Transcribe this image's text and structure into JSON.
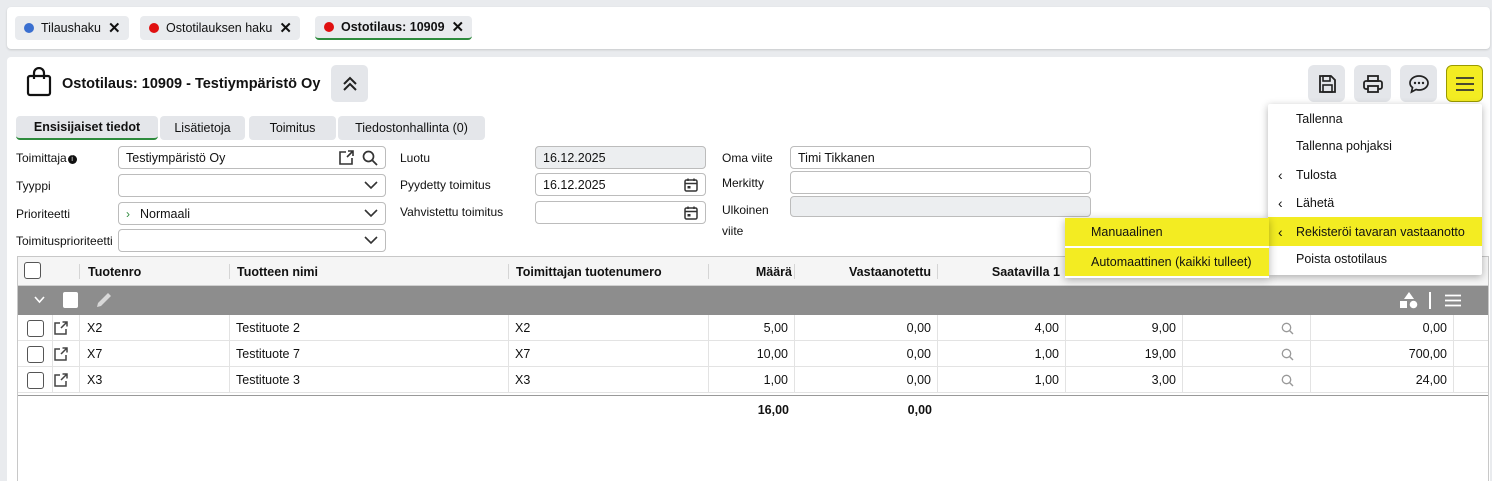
{
  "page_tabs": [
    {
      "label": "Tilaushaku",
      "dot_color": "#3a6fd0"
    },
    {
      "label": "Ostotilauksen haku",
      "dot_color": "#e01010"
    },
    {
      "label": "Ostotilaus: 10909",
      "dot_color": "#e01010",
      "active": true
    }
  ],
  "header": {
    "title": "Ostotilaus: 10909 - Testiympäristö Oy"
  },
  "sub_tabs": [
    "Ensisijaiset tiedot",
    "Lisätietoja",
    "Toimitus",
    "Tiedostonhallinta (0)"
  ],
  "form": {
    "supplier_label": "Toimittaja",
    "supplier_value": "Testiympäristö Oy",
    "type_label": "Tyyppi",
    "type_value": "",
    "priority_label": "Prioriteetti",
    "priority_value": "Normaali",
    "delivery_priority_label": "Toimitusprioriteetti",
    "delivery_priority_value": "",
    "created_label": "Luotu",
    "created_value": "16.12.2025",
    "requested_label": "Pyydetty toimitus",
    "requested_value": "16.12.2025",
    "confirmed_label": "Vahvistettu toimitus",
    "confirmed_value": "",
    "own_ref_label": "Oma viite",
    "own_ref_value": "Timi Tikkanen",
    "marked_label": "Merkitty",
    "marked_value": "",
    "ext_ref_label_1": "Ulkoinen",
    "ext_ref_label_2": "viite",
    "ext_ref_value": ""
  },
  "grid": {
    "columns": [
      "Tuotenro",
      "Tuotteen nimi",
      "Toimittajan tuotenumero",
      "Määrä",
      "Vastaanotettu",
      "Saatavilla 1"
    ],
    "rows": [
      {
        "code": "X2",
        "name": "Testituote 2",
        "supplier_code": "X2",
        "qty": "5,00",
        "received": "0,00",
        "avail": "4,00",
        "c7": "9,00",
        "c9": "0,00"
      },
      {
        "code": "X7",
        "name": "Testituote 7",
        "supplier_code": "X7",
        "qty": "10,00",
        "received": "0,00",
        "avail": "1,00",
        "c7": "19,00",
        "c9": "700,00"
      },
      {
        "code": "X3",
        "name": "Testituote 3",
        "supplier_code": "X3",
        "qty": "1,00",
        "received": "0,00",
        "avail": "1,00",
        "c7": "3,00",
        "c9": "24,00"
      }
    ],
    "totals": {
      "qty": "16,00",
      "received": "0,00"
    }
  },
  "menu": {
    "items": [
      "Tallenna",
      "Tallenna pohjaksi",
      "Tulosta",
      "Lähetä",
      "Rekisteröi tavaran vastaanotto",
      "Poista ostotilaus"
    ],
    "highlight_color": "#f3ec22"
  },
  "submenu": {
    "items": [
      "Manuaalinen",
      "Automaattinen (kaikki tulleet)"
    ]
  }
}
